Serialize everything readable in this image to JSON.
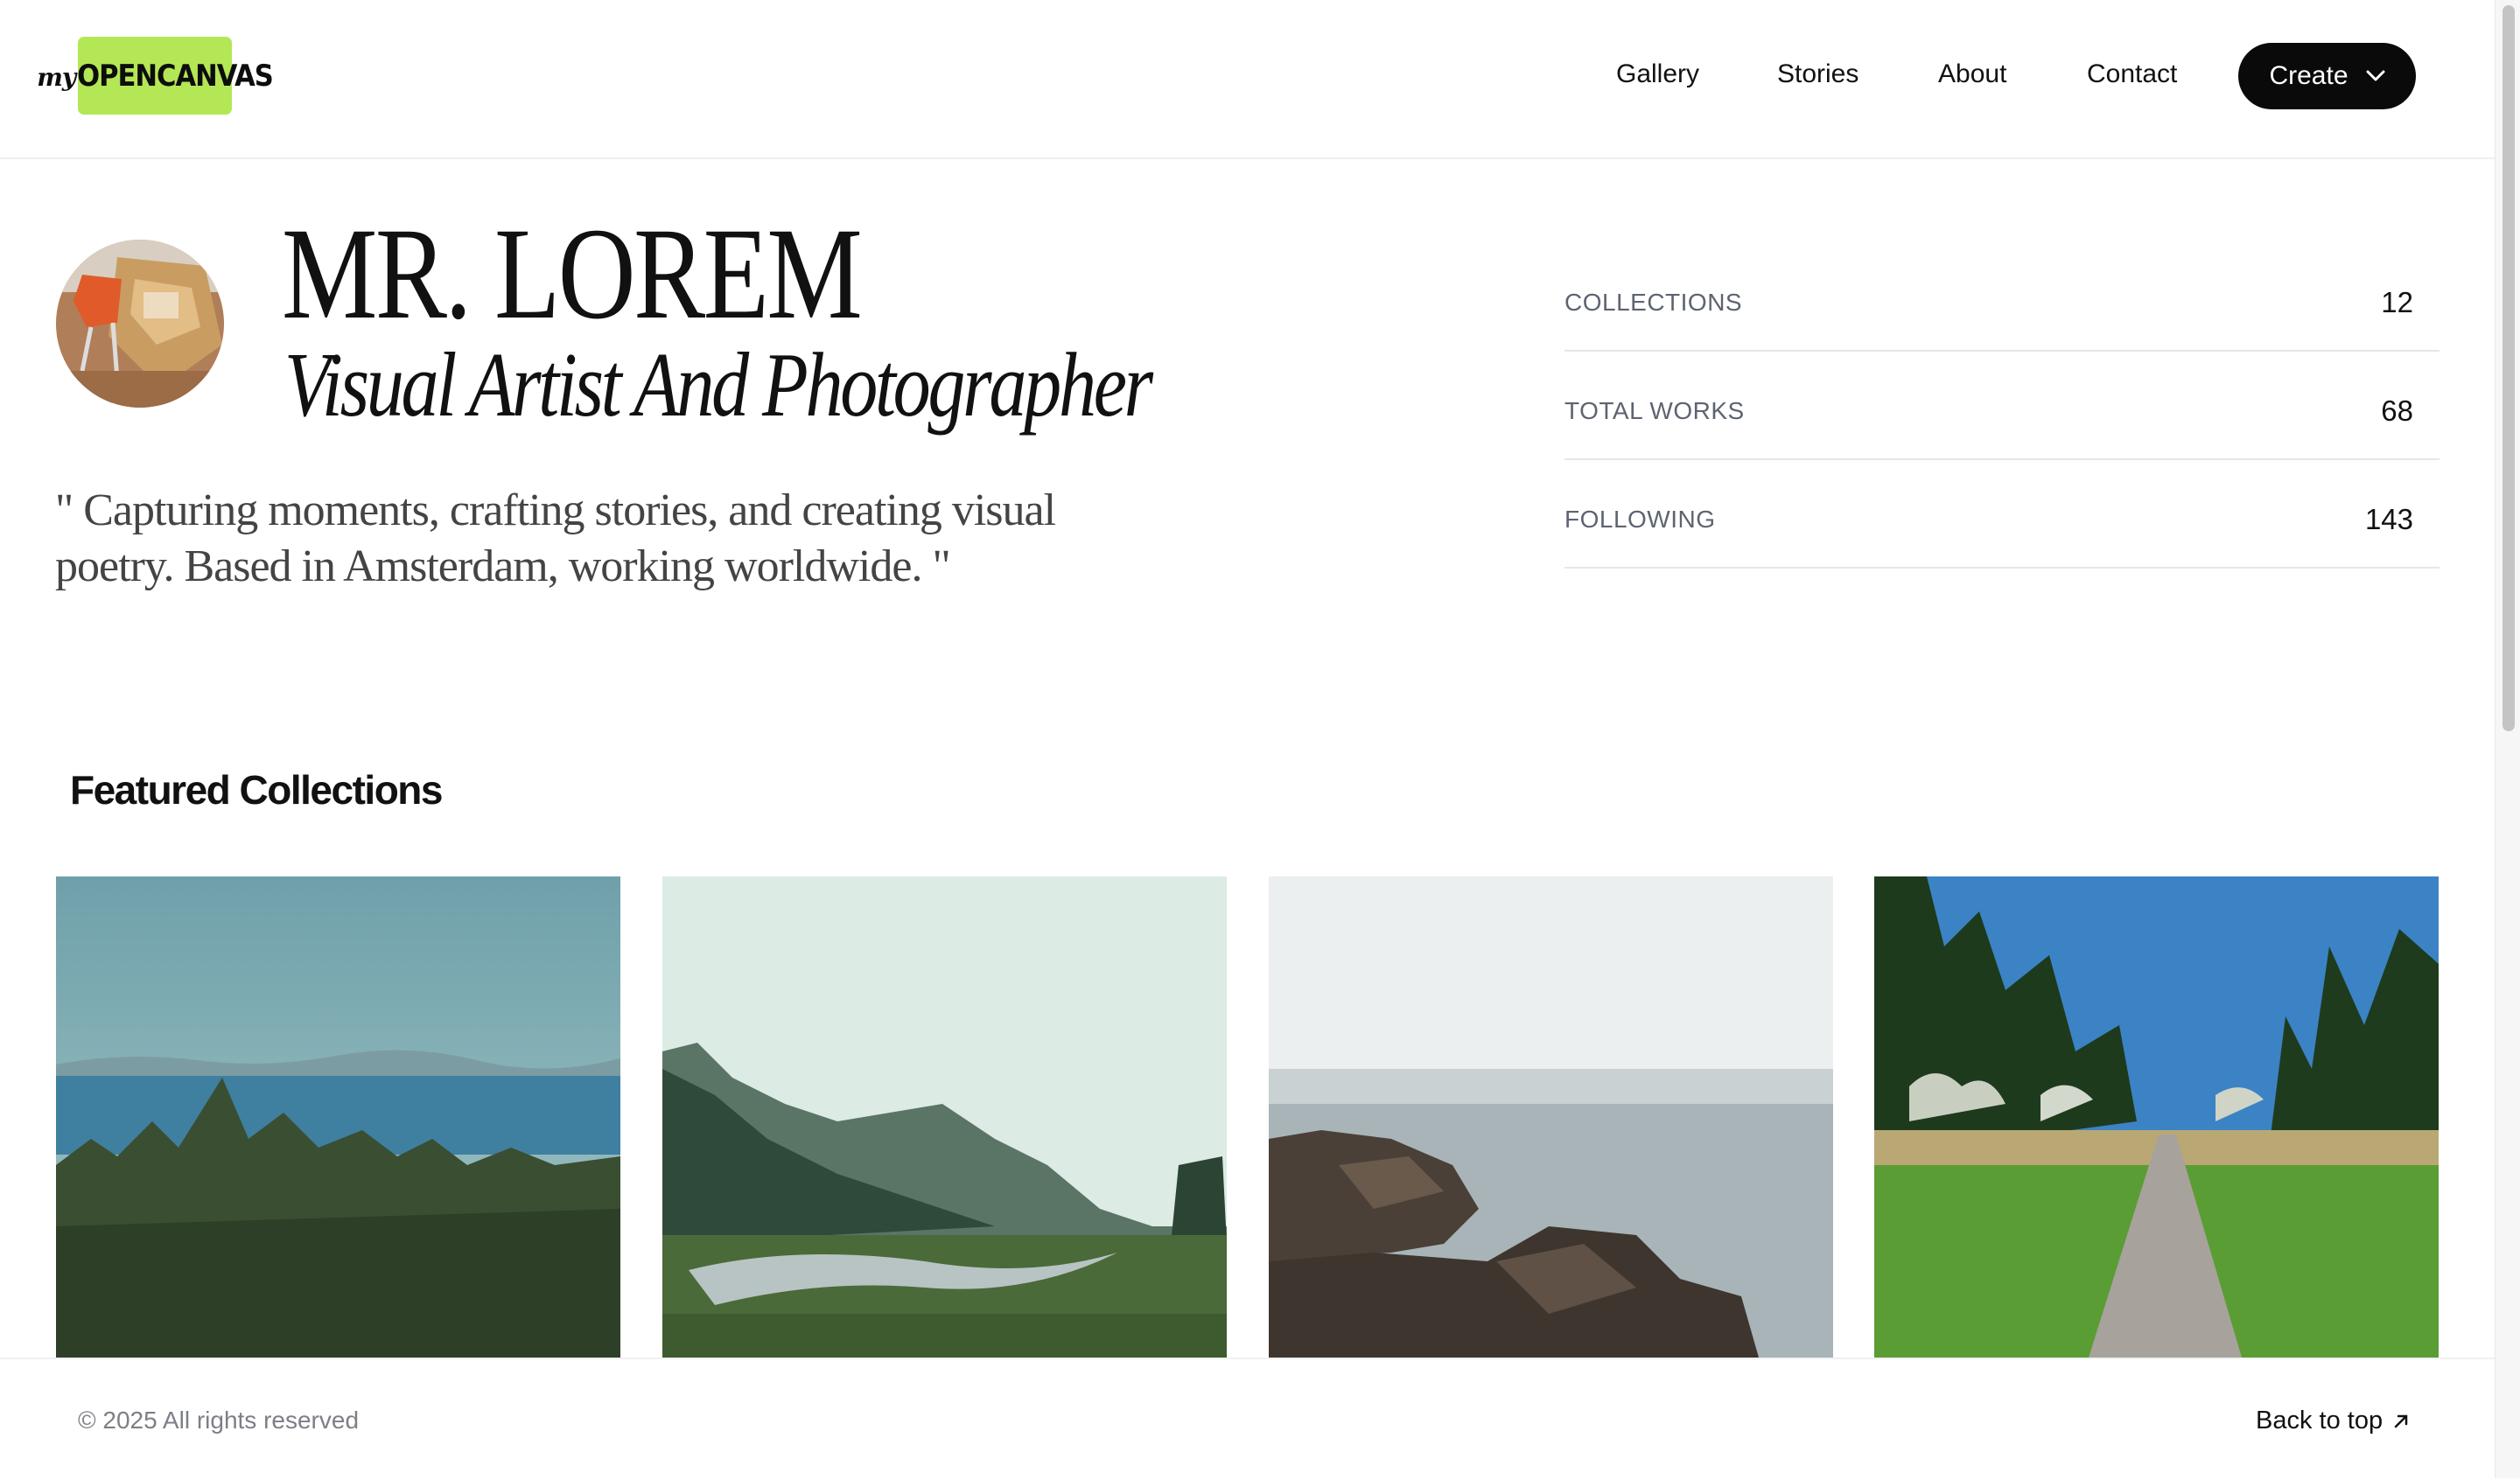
{
  "header": {
    "logo_text": "myOPENCANVAS",
    "logo_script": "my",
    "logo_caps": "OPENCANVAS",
    "nav": [
      "Gallery",
      "Stories",
      "About",
      "Contact"
    ],
    "create_label": "Create",
    "logo_color": "#b4e755"
  },
  "profile": {
    "name": "MR. LOREM",
    "subtitle": "Visual Artist And Photographer",
    "quote": "\" Capturing moments, crafting stories, and creating visual poetry. Based in Amsterdam, working worldwide. \""
  },
  "stats": [
    {
      "label": "COLLECTIONS",
      "value": "12"
    },
    {
      "label": "TOTAL WORKS",
      "value": "68"
    },
    {
      "label": "FOLLOWING",
      "value": "143"
    }
  ],
  "featured": {
    "title": "Featured Collections"
  },
  "footer": {
    "copyright": "© 2025 All rights reserved",
    "back_to_top": "Back to top"
  }
}
